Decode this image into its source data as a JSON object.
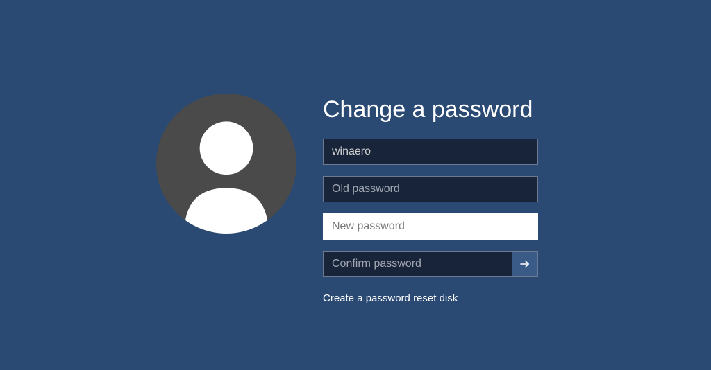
{
  "title": "Change a password",
  "username": "winaero",
  "old_password_placeholder": "Old password",
  "new_password_placeholder": "New password",
  "confirm_password_placeholder": "Confirm password",
  "reset_link": "Create a password reset disk"
}
